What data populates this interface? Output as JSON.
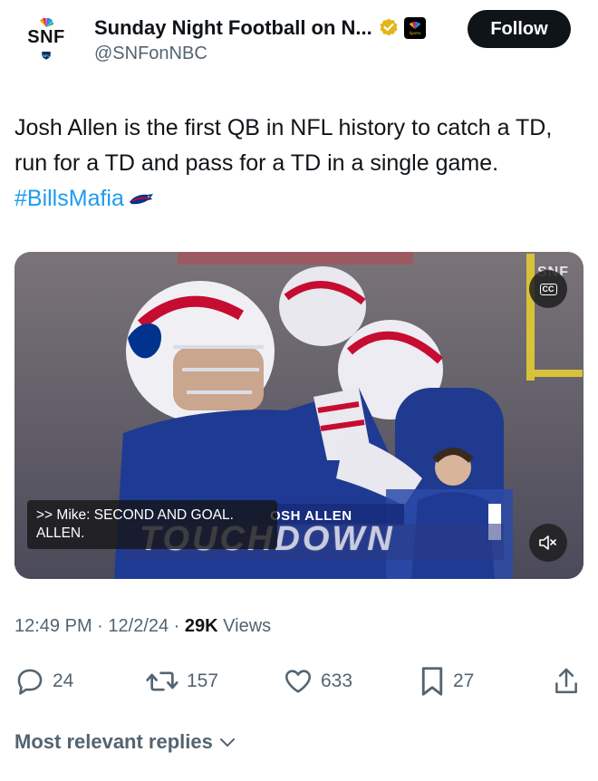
{
  "profile": {
    "avatar_text": "SNF",
    "display_name": "Sunday Night Football on N...",
    "handle": "@SNFonNBC",
    "verified": "gold-check",
    "affiliate_badge": "nbc-sports-badge"
  },
  "header": {
    "follow_label": "Follow"
  },
  "tweet": {
    "text": "Josh Allen is the first QB in NFL history to catch a TD, run for a TD and pass for a TD in a single game.",
    "hashtag": "#BillsMafia",
    "emoji": "buffalo-icon"
  },
  "video": {
    "watermark": "SNF",
    "cc_label": "CC",
    "caption_line1": ">> Mike: SECOND AND GOAL.",
    "caption_line2": "ALLEN.",
    "lower_third_name": "OSH ALLEN",
    "lower_third_word": "TOUCHDOWN",
    "mute_icon": "speaker-muted-icon"
  },
  "meta": {
    "time": "12:49 PM",
    "date": "12/2/24",
    "views_count": "29K",
    "views_label": "Views"
  },
  "actions": {
    "replies": "24",
    "reposts": "157",
    "likes": "633",
    "bookmarks": "27"
  },
  "replies_sort": {
    "label": "Most relevant replies"
  },
  "colors": {
    "text": "#0f1419",
    "secondary": "#536471",
    "link": "#1d9bf0",
    "follow_bg": "#0f1419",
    "verified_gold": "#e2b719"
  }
}
